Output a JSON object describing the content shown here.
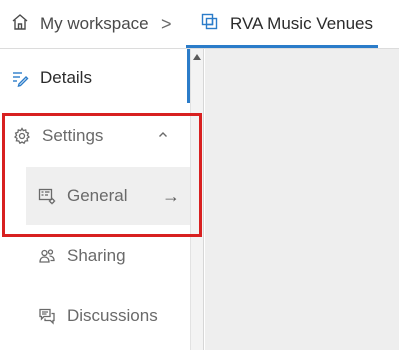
{
  "breadcrumb": {
    "home_label": "My workspace",
    "separator": ">",
    "current_label": "RVA Music Venues",
    "accent_color": "#2b7cc9"
  },
  "sidebar": {
    "details_label": "Details",
    "settings_label": "Settings",
    "settings_expanded": true,
    "sub_items": [
      {
        "label": "General",
        "icon": "general-settings-icon",
        "selected": true,
        "arrow": "→"
      },
      {
        "label": "Sharing",
        "icon": "users-icon"
      },
      {
        "label": "Discussions",
        "icon": "chat-icon"
      }
    ]
  },
  "highlight_color": "#d82020"
}
